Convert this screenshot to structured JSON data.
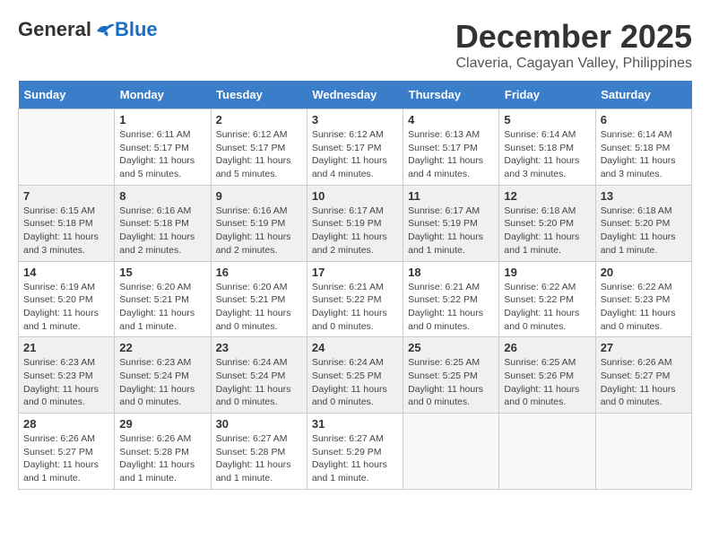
{
  "logo": {
    "general": "General",
    "blue": "Blue"
  },
  "title": {
    "month": "December 2025",
    "location": "Claveria, Cagayan Valley, Philippines"
  },
  "headers": [
    "Sunday",
    "Monday",
    "Tuesday",
    "Wednesday",
    "Thursday",
    "Friday",
    "Saturday"
  ],
  "weeks": [
    [
      {
        "day": "",
        "info": ""
      },
      {
        "day": "1",
        "info": "Sunrise: 6:11 AM\nSunset: 5:17 PM\nDaylight: 11 hours\nand 5 minutes."
      },
      {
        "day": "2",
        "info": "Sunrise: 6:12 AM\nSunset: 5:17 PM\nDaylight: 11 hours\nand 5 minutes."
      },
      {
        "day": "3",
        "info": "Sunrise: 6:12 AM\nSunset: 5:17 PM\nDaylight: 11 hours\nand 4 minutes."
      },
      {
        "day": "4",
        "info": "Sunrise: 6:13 AM\nSunset: 5:17 PM\nDaylight: 11 hours\nand 4 minutes."
      },
      {
        "day": "5",
        "info": "Sunrise: 6:14 AM\nSunset: 5:18 PM\nDaylight: 11 hours\nand 3 minutes."
      },
      {
        "day": "6",
        "info": "Sunrise: 6:14 AM\nSunset: 5:18 PM\nDaylight: 11 hours\nand 3 minutes."
      }
    ],
    [
      {
        "day": "7",
        "info": "Sunrise: 6:15 AM\nSunset: 5:18 PM\nDaylight: 11 hours\nand 3 minutes."
      },
      {
        "day": "8",
        "info": "Sunrise: 6:16 AM\nSunset: 5:18 PM\nDaylight: 11 hours\nand 2 minutes."
      },
      {
        "day": "9",
        "info": "Sunrise: 6:16 AM\nSunset: 5:19 PM\nDaylight: 11 hours\nand 2 minutes."
      },
      {
        "day": "10",
        "info": "Sunrise: 6:17 AM\nSunset: 5:19 PM\nDaylight: 11 hours\nand 2 minutes."
      },
      {
        "day": "11",
        "info": "Sunrise: 6:17 AM\nSunset: 5:19 PM\nDaylight: 11 hours\nand 1 minute."
      },
      {
        "day": "12",
        "info": "Sunrise: 6:18 AM\nSunset: 5:20 PM\nDaylight: 11 hours\nand 1 minute."
      },
      {
        "day": "13",
        "info": "Sunrise: 6:18 AM\nSunset: 5:20 PM\nDaylight: 11 hours\nand 1 minute."
      }
    ],
    [
      {
        "day": "14",
        "info": "Sunrise: 6:19 AM\nSunset: 5:20 PM\nDaylight: 11 hours\nand 1 minute."
      },
      {
        "day": "15",
        "info": "Sunrise: 6:20 AM\nSunset: 5:21 PM\nDaylight: 11 hours\nand 1 minute."
      },
      {
        "day": "16",
        "info": "Sunrise: 6:20 AM\nSunset: 5:21 PM\nDaylight: 11 hours\nand 0 minutes."
      },
      {
        "day": "17",
        "info": "Sunrise: 6:21 AM\nSunset: 5:22 PM\nDaylight: 11 hours\nand 0 minutes."
      },
      {
        "day": "18",
        "info": "Sunrise: 6:21 AM\nSunset: 5:22 PM\nDaylight: 11 hours\nand 0 minutes."
      },
      {
        "day": "19",
        "info": "Sunrise: 6:22 AM\nSunset: 5:22 PM\nDaylight: 11 hours\nand 0 minutes."
      },
      {
        "day": "20",
        "info": "Sunrise: 6:22 AM\nSunset: 5:23 PM\nDaylight: 11 hours\nand 0 minutes."
      }
    ],
    [
      {
        "day": "21",
        "info": "Sunrise: 6:23 AM\nSunset: 5:23 PM\nDaylight: 11 hours\nand 0 minutes."
      },
      {
        "day": "22",
        "info": "Sunrise: 6:23 AM\nSunset: 5:24 PM\nDaylight: 11 hours\nand 0 minutes."
      },
      {
        "day": "23",
        "info": "Sunrise: 6:24 AM\nSunset: 5:24 PM\nDaylight: 11 hours\nand 0 minutes."
      },
      {
        "day": "24",
        "info": "Sunrise: 6:24 AM\nSunset: 5:25 PM\nDaylight: 11 hours\nand 0 minutes."
      },
      {
        "day": "25",
        "info": "Sunrise: 6:25 AM\nSunset: 5:25 PM\nDaylight: 11 hours\nand 0 minutes."
      },
      {
        "day": "26",
        "info": "Sunrise: 6:25 AM\nSunset: 5:26 PM\nDaylight: 11 hours\nand 0 minutes."
      },
      {
        "day": "27",
        "info": "Sunrise: 6:26 AM\nSunset: 5:27 PM\nDaylight: 11 hours\nand 0 minutes."
      }
    ],
    [
      {
        "day": "28",
        "info": "Sunrise: 6:26 AM\nSunset: 5:27 PM\nDaylight: 11 hours\nand 1 minute."
      },
      {
        "day": "29",
        "info": "Sunrise: 6:26 AM\nSunset: 5:28 PM\nDaylight: 11 hours\nand 1 minute."
      },
      {
        "day": "30",
        "info": "Sunrise: 6:27 AM\nSunset: 5:28 PM\nDaylight: 11 hours\nand 1 minute."
      },
      {
        "day": "31",
        "info": "Sunrise: 6:27 AM\nSunset: 5:29 PM\nDaylight: 11 hours\nand 1 minute."
      },
      {
        "day": "",
        "info": ""
      },
      {
        "day": "",
        "info": ""
      },
      {
        "day": "",
        "info": ""
      }
    ]
  ]
}
